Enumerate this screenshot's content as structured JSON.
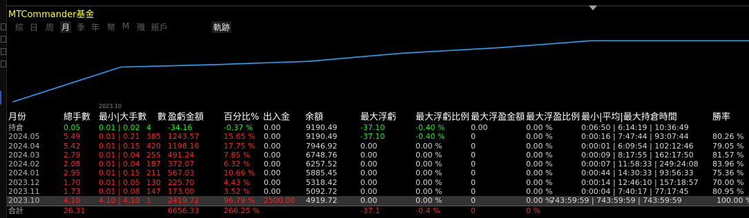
{
  "window": {
    "title": "MTCommander基金"
  },
  "tabs": [
    {
      "label": "綜"
    },
    {
      "label": "日"
    },
    {
      "label": "周"
    },
    {
      "label": "月"
    },
    {
      "label": "季"
    },
    {
      "label": "年"
    },
    {
      "label": "幣"
    },
    {
      "label": "M"
    },
    {
      "label": "殲"
    },
    {
      "label": "賬戶"
    },
    {
      "label": "軌跡"
    }
  ],
  "active_tab": "月",
  "chart_data": {
    "type": "line",
    "x": [
      "2023.10",
      "2023.11",
      "2023.12",
      "2024.01",
      "2024.02",
      "2024.03",
      "2024.04",
      "2024.05"
    ],
    "y": [
      0,
      2419.72,
      2593.45,
      2819.15,
      3386.18,
      3758.25,
      4249.49,
      4249.49
    ],
    "tick_labels": [
      "2023.10"
    ],
    "line_color": "#1ea7ff",
    "grid": false
  },
  "table": {
    "headers": [
      "月份",
      "總手數",
      "最小|大手數",
      "數",
      "盈虧金額",
      "百分比%",
      "出入金",
      "余額",
      "最大浮虧",
      "最大浮虧比例",
      "最大浮盈金額",
      "最大浮盈比例",
      "最小|平均|最大持倉時間",
      "勝率"
    ],
    "rows": [
      {
        "label": "持倉",
        "lots": "0.05",
        "minmax": "0.01 | 0.02",
        "count": "4",
        "pl": "-34.16",
        "pct": "-0.37 %",
        "io": "0.00",
        "bal": "9190.49",
        "mdd": "-37.10",
        "mddp": "-0.40 %",
        "mfe": "0.00",
        "mfep": "0.00 %",
        "hold": "0:06:50 | 6:14:19 | 10:36:49",
        "win": ""
      },
      {
        "label": "2024.05",
        "lots": "5.49",
        "minmax": "0.01 | 0.21",
        "count": "385",
        "pl": "1243.57",
        "pct": "15.65 %",
        "io": "0.00",
        "bal": "9190.49",
        "mdd": "-37.10",
        "mddp": "-0.40 %",
        "mfe": "0",
        "mfep": "0.00 %",
        "hold": "0:00:16 | 7:47:44 | 93:07:44",
        "win": "80.26 %"
      },
      {
        "label": "2024.04",
        "lots": "5.42",
        "minmax": "0.01 | 0.15",
        "count": "420",
        "pl": "1198.16",
        "pct": "17.75 %",
        "io": "0.00",
        "bal": "7946.92",
        "mdd": "0.00",
        "mddp": "0.00 %",
        "mfe": "0",
        "mfep": "0.00 %",
        "hold": "0:00:01 | 6:09:54 | 102:12:46",
        "win": "79.05 %"
      },
      {
        "label": "2024.03",
        "lots": "2.79",
        "minmax": "0.01 | 0.04",
        "count": "255",
        "pl": "491.24",
        "pct": "7.85 %",
        "io": "0.00",
        "bal": "6748.76",
        "mdd": "0.00",
        "mddp": "0.00 %",
        "mfe": "0",
        "mfep": "0.00 %",
        "hold": "0:00:09 | 8:17:55 | 162:17:50",
        "win": "81.57 %"
      },
      {
        "label": "2024.02",
        "lots": "2.08",
        "minmax": "0.01 | 0.04",
        "count": "187",
        "pl": "372.07",
        "pct": "6.32 %",
        "io": "0.00",
        "bal": "6257.52",
        "mdd": "0.00",
        "mddp": "0.00 %",
        "mfe": "0",
        "mfep": "0.00 %",
        "hold": "0:00:07 | 11:58:33 | 249:24:08",
        "win": "83.96 %"
      },
      {
        "label": "2024.01",
        "lots": "2.95",
        "minmax": "0.01 | 0.15",
        "count": "211",
        "pl": "567.03",
        "pct": "10.66 %",
        "io": "0.00",
        "bal": "5885.45",
        "mdd": "0.00",
        "mddp": "0.00 %",
        "mfe": "0",
        "mfep": "0.00 %",
        "hold": "0:00:44 | 14:30:33 | 93:56:33",
        "win": "75.36 %"
      },
      {
        "label": "2023.12",
        "lots": "1.70",
        "minmax": "0.01 | 0.05",
        "count": "130",
        "pl": "225.70",
        "pct": "4.43 %",
        "io": "0.00",
        "bal": "5318.42",
        "mdd": "0.00",
        "mddp": "0.00 %",
        "mfe": "0",
        "mfep": "0.00 %",
        "hold": "0:00:14 | 12:46:10 | 157:18:57",
        "win": "70.00 %"
      },
      {
        "label": "2023.11",
        "lots": "1.73",
        "minmax": "0.01 | 0.08",
        "count": "147",
        "pl": "173.00",
        "pct": "3.52 %",
        "io": "0.00",
        "bal": "5092.72",
        "mdd": "0.00",
        "mddp": "0.00 %",
        "mfe": "0",
        "mfep": "0.00 %",
        "hold": "0:00:04 | 7:40:17 | 77:17:45",
        "win": "80.95 %"
      },
      {
        "label": "2023.10",
        "lots": "4.10",
        "minmax": "4.10 | 4.10",
        "count": "1",
        "pl": "2419.72",
        "pct": "96.79 %",
        "io": "2500.00",
        "bal": "4919.72",
        "mdd": "0.00",
        "mddp": "0.00 %",
        "mfe": "0",
        "mfep": "0.00 %",
        "hold": "743:59:59 | 743:59:59 | 743:59:59",
        "win": "100.00 %"
      }
    ],
    "footer": {
      "label": "合計",
      "lots": "26.31",
      "pl": "6656.33",
      "pct": "266.25 %",
      "mdd": "-37.1",
      "mddp": "-0.4 %",
      "mfe": "0",
      "mfep": "0 %"
    }
  }
}
